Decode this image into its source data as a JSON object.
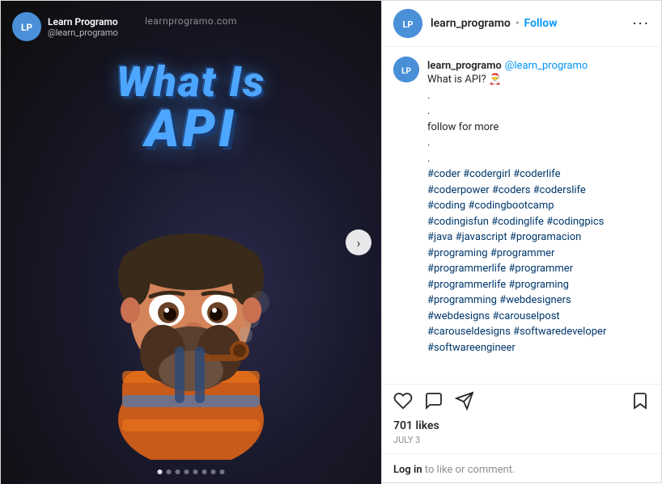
{
  "left": {
    "watermark": "learnprogramo.com",
    "account_name": "Learn Programo",
    "account_handle": "@learn_programo",
    "title_line1": "What Is",
    "title_line2": "API",
    "dots_count": 8,
    "active_dot": 0
  },
  "right": {
    "header": {
      "username": "learn_programo",
      "separator": "•",
      "follow_label": "Follow",
      "more_icon": "···"
    },
    "comment": {
      "username": "learn_programo",
      "handle": "@learn_programo",
      "text": "What is API? 🎅\n.\n.\nfollow for more\n.\n.\n#coder #codergirl #coderlife\n#coderpower #coders #coderslife\n#coding #codingbootcamp\n#codingisfun #codinglife #codingpics\n#java #javascript #programacion\n#programing #programmer\n#programmerlife #programmer\n#programmerlife #programing\n#programming #webdesigners\n#webdesigns #carouselpost\n#carouseldesigns #softwaredeveloper\n#softwareengineer"
    },
    "actions": {
      "like_icon": "♡",
      "comment_icon": "💬",
      "share_icon": "➤",
      "bookmark_icon": "🔖"
    },
    "likes": "701 likes",
    "date": "July 3",
    "login_prompt": "Log in to like or comment.",
    "login_link": "Log in"
  }
}
